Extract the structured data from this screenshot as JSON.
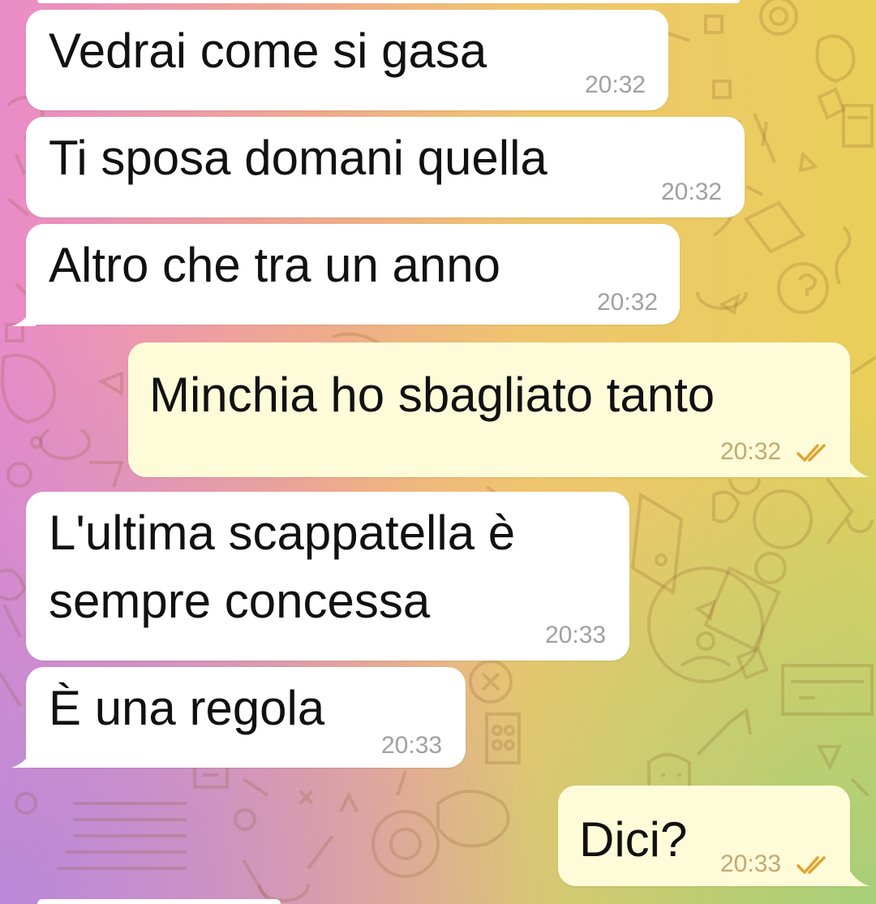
{
  "messages": [
    {
      "text": "Vedrai come si gasa",
      "time": "20:32"
    },
    {
      "text": "Ti sposa domani quella",
      "time": "20:32"
    },
    {
      "text": "Altro che tra un anno",
      "time": "20:32"
    },
    {
      "text": "Minchia ho sbagliato tanto",
      "time": "20:32"
    },
    {
      "text": "L'ultima scappatella è",
      "text2": "sempre concessa",
      "time": "20:33"
    },
    {
      "text": "È una regola",
      "time": "20:33"
    },
    {
      "text": "Dici?",
      "time": "20:33"
    }
  ],
  "icons": {
    "read_receipt": "double-check-icon"
  },
  "colors": {
    "incoming": "#ffffff",
    "outgoing": "#fefbd9",
    "tick": "#e0a431"
  }
}
